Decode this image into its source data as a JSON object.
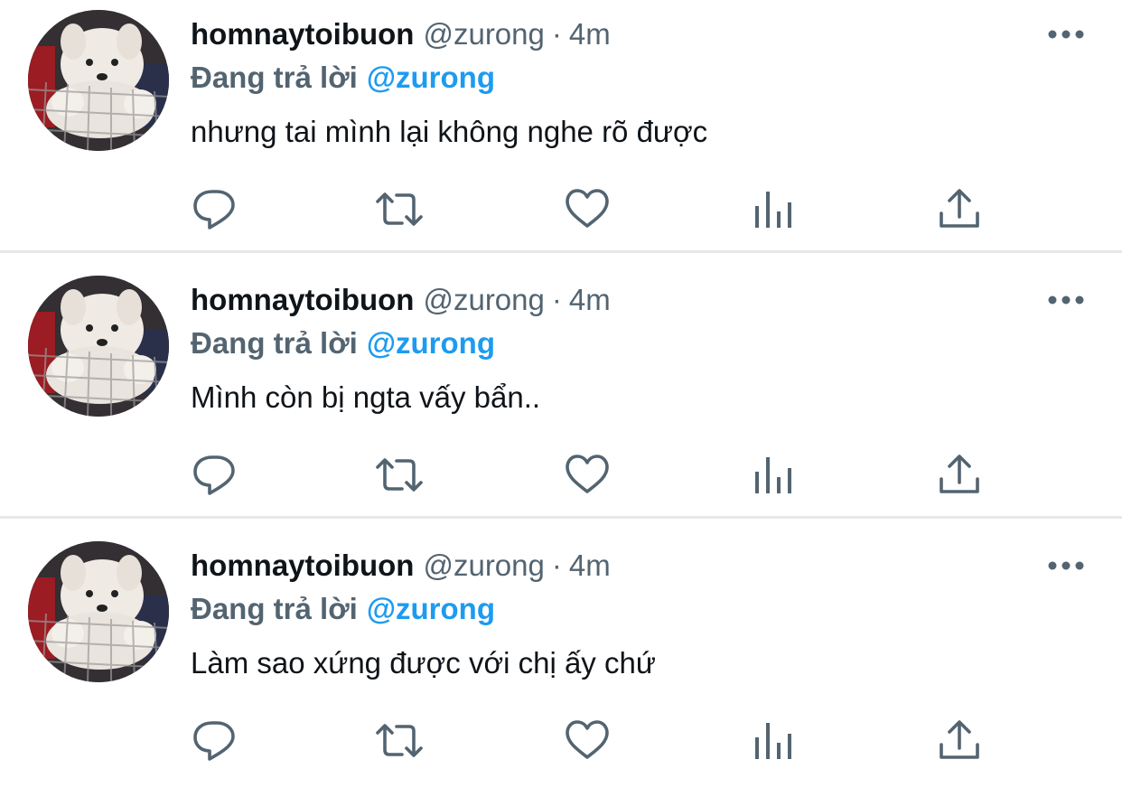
{
  "tweets": [
    {
      "display_name": "homnaytoibuon",
      "handle": "@zurong",
      "separator": "·",
      "time": "4m",
      "reply_prefix": "Đang trả lời",
      "reply_handle": "@zurong",
      "text": "nhưng tai mình lại không nghe rõ được"
    },
    {
      "display_name": "homnaytoibuon",
      "handle": "@zurong",
      "separator": "·",
      "time": "4m",
      "reply_prefix": "Đang trả lời",
      "reply_handle": "@zurong",
      "text": "Mình còn bị ngta vấy bẩn.."
    },
    {
      "display_name": "homnaytoibuon",
      "handle": "@zurong",
      "separator": "·",
      "time": "4m",
      "reply_prefix": "Đang trả lời",
      "reply_handle": "@zurong",
      "text": "Làm sao xứng được với chị ấy chứ"
    }
  ],
  "icons": {
    "more": "more-horizontal-icon",
    "reply": "reply-bubble-icon",
    "retweet": "retweet-icon",
    "like": "heart-icon",
    "analytics": "analytics-bars-icon",
    "share": "share-upload-icon"
  },
  "colors": {
    "text": "#0f1419",
    "secondary": "#536471",
    "accent": "#1d9bf0",
    "divider": "#e6e9ec"
  }
}
